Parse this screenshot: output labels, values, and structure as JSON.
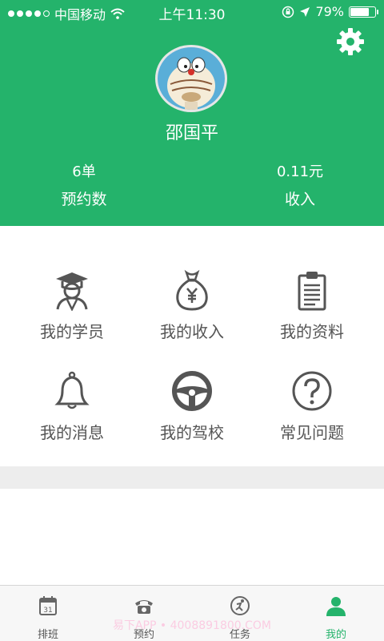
{
  "status_bar": {
    "carrier": "中国移动",
    "time": "上午11:30",
    "battery_percent": "79%",
    "battery_level": 0.79
  },
  "profile": {
    "username": "邵国平"
  },
  "stats": [
    {
      "value": "6单",
      "label": "预约数"
    },
    {
      "value": "0.11元",
      "label": "收入"
    }
  ],
  "menu": [
    {
      "label": "我的学员",
      "icon": "graduate-icon"
    },
    {
      "label": "我的收入",
      "icon": "money-bag-icon"
    },
    {
      "label": "我的资料",
      "icon": "clipboard-icon"
    },
    {
      "label": "我的消息",
      "icon": "bell-icon"
    },
    {
      "label": "我的驾校",
      "icon": "steering-wheel-icon"
    },
    {
      "label": "常见问题",
      "icon": "question-icon"
    }
  ],
  "tabs": [
    {
      "label": "排班",
      "icon": "calendar-icon",
      "calendar_day": "31"
    },
    {
      "label": "预约",
      "icon": "telephone-icon"
    },
    {
      "label": "任务",
      "icon": "task-icon"
    },
    {
      "label": "我的",
      "icon": "person-icon",
      "active": true
    }
  ],
  "watermark": "易下APP • 4008891800.COM",
  "colors": {
    "brand_green": "#24b36b",
    "band_gray": "#ededed",
    "icon_gray": "#555555"
  }
}
